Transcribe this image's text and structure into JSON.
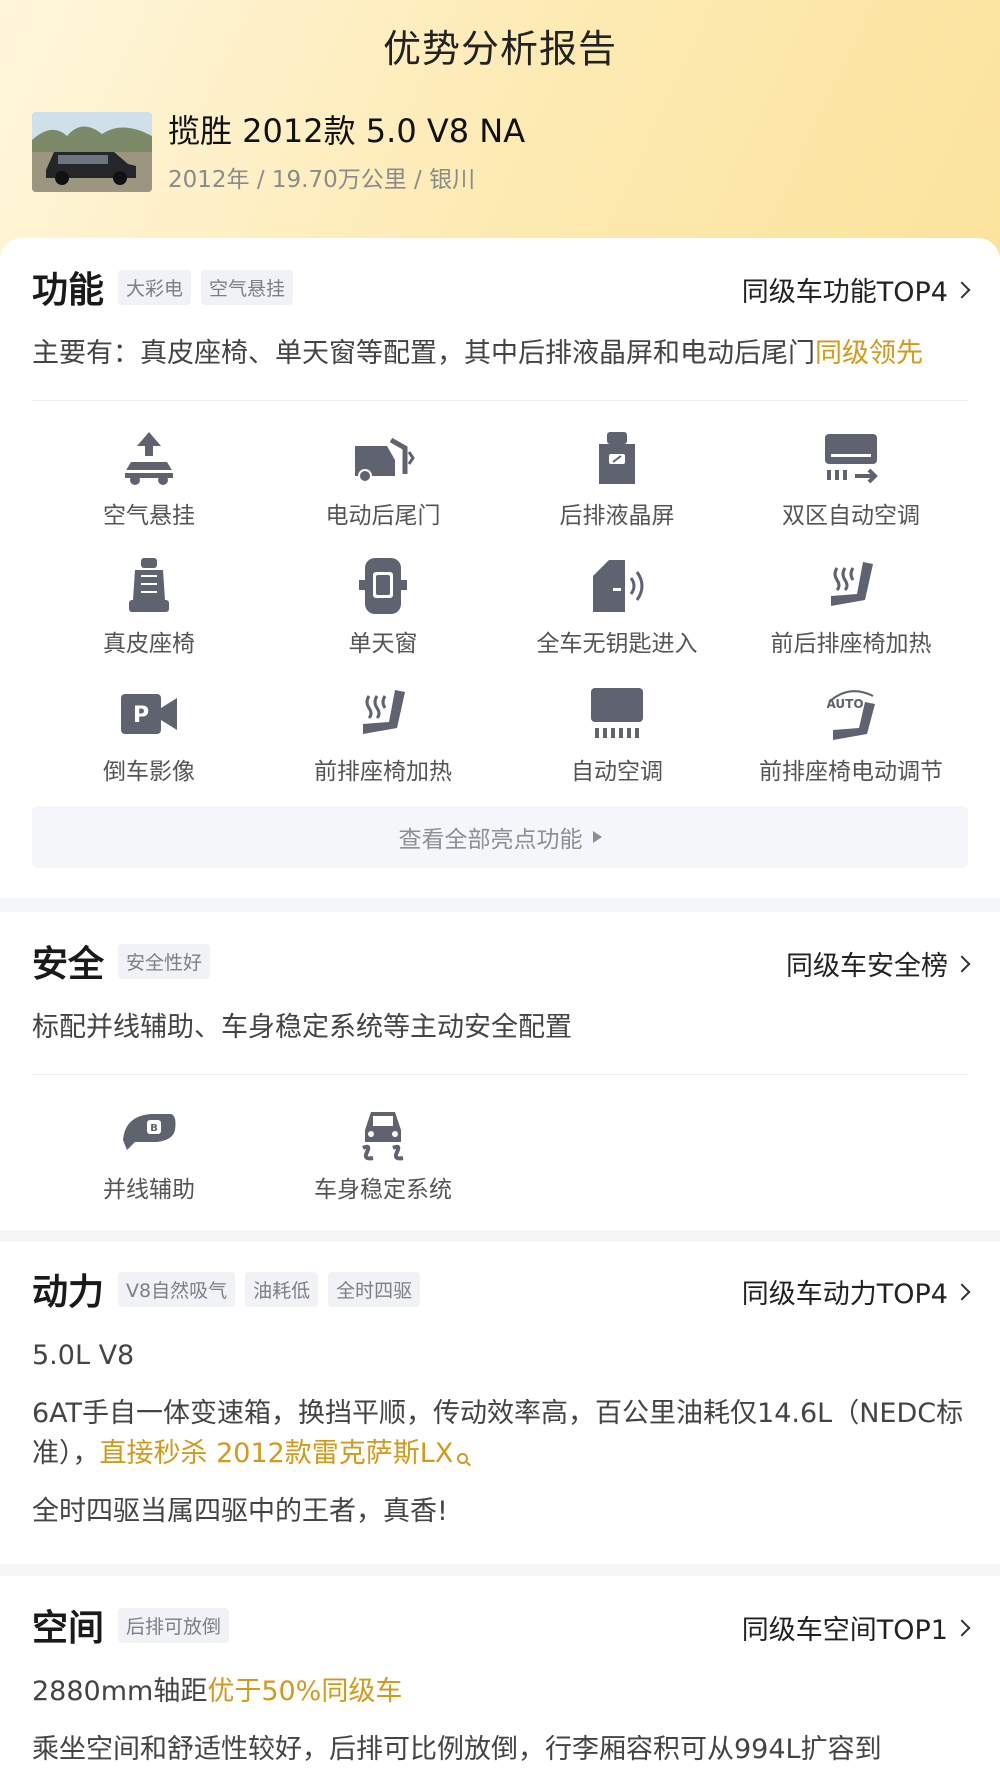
{
  "header": {
    "title": "优势分析报告",
    "car_name": "揽胜 2012款 5.0 V8 NA",
    "car_meta": "2012年 / 19.70万公里 / 银川"
  },
  "function": {
    "title": "功能",
    "tags": [
      "大彩电",
      "空气悬挂"
    ],
    "link": "同级车功能TOP4",
    "desc_main": "主要有：真皮座椅、单天窗等配置，其中后排液晶屏和电动后尾门",
    "desc_hl": "同级领先",
    "features": [
      {
        "label": "空气悬挂",
        "icon": "air-suspension-icon"
      },
      {
        "label": "电动后尾门",
        "icon": "power-tailgate-icon"
      },
      {
        "label": "后排液晶屏",
        "icon": "rear-screen-icon"
      },
      {
        "label": "双区自动空调",
        "icon": "dual-zone-ac-icon"
      },
      {
        "label": "真皮座椅",
        "icon": "leather-seat-icon"
      },
      {
        "label": "单天窗",
        "icon": "sunroof-icon"
      },
      {
        "label": "全车无钥匙进入",
        "icon": "keyless-entry-icon"
      },
      {
        "label": "前后排座椅加热",
        "icon": "seat-heating-all-icon"
      },
      {
        "label": "倒车影像",
        "icon": "reverse-camera-icon"
      },
      {
        "label": "前排座椅加热",
        "icon": "front-seat-heating-icon"
      },
      {
        "label": "自动空调",
        "icon": "auto-ac-icon"
      },
      {
        "label": "前排座椅电动调节",
        "icon": "power-seat-icon"
      }
    ],
    "view_all": "查看全部亮点功能",
    "auto_text": "AUTO",
    "p_text": "P"
  },
  "safety": {
    "title": "安全",
    "tags": [
      "安全性好"
    ],
    "link": "同级车安全榜",
    "desc": "标配并线辅助、车身稳定系统等主动安全配置",
    "features": [
      {
        "label": "并线辅助",
        "icon": "blind-spot-icon"
      },
      {
        "label": "车身稳定系统",
        "icon": "esp-icon"
      }
    ]
  },
  "power": {
    "title": "动力",
    "tags": [
      "V8自然吸气",
      "油耗低",
      "全时四驱"
    ],
    "link": "同级车动力TOP4",
    "engine": "5.0L V8",
    "desc_main": "6AT手自一体变速箱，换挡平顺，传动效率高，百公里油耗仅14.6L（NEDC标准），",
    "desc_hl": "直接秒杀 2012款雷克萨斯LX",
    "desc2": "全时四驱当属四驱中的王者，真香!"
  },
  "space": {
    "title": "空间",
    "tags": [
      "后排可放倒"
    ],
    "link": "同级车空间TOP1",
    "wheelbase_main": "2880mm轴距",
    "wheelbase_hl": "优于50%同级车",
    "desc": "乘坐空间和舒适性较好，后排可比例放倒，行李厢容积可从994L扩容到"
  },
  "colors": {
    "accent": "#d19a1b",
    "icon": "#5f6370"
  }
}
